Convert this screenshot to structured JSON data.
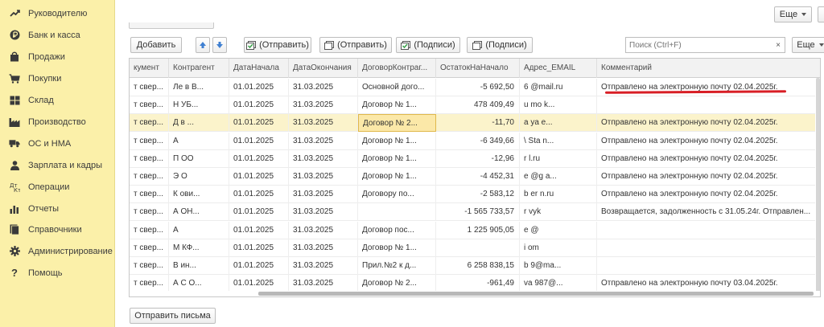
{
  "colors": {
    "sidebar_bg": "#fbf0a9",
    "selection_bg": "#fbf3cb",
    "accent_red": "#d81e25",
    "arrow_blue": "#3f7fd1",
    "check_green": "#3aa14a"
  },
  "sidebar": {
    "items": [
      {
        "label": "Руководителю",
        "icon": "chart-trend-icon"
      },
      {
        "label": "Банк и касса",
        "icon": "ruble-coin-icon"
      },
      {
        "label": "Продажи",
        "icon": "shopping-bag-icon"
      },
      {
        "label": "Покупки",
        "icon": "cart-icon"
      },
      {
        "label": "Склад",
        "icon": "warehouse-icon"
      },
      {
        "label": "Производство",
        "icon": "factory-icon"
      },
      {
        "label": "ОС и НМА",
        "icon": "truck-icon"
      },
      {
        "label": "Зарплата и кадры",
        "icon": "people-icon"
      },
      {
        "label": "Операции",
        "icon": "operations-icon"
      },
      {
        "label": "Отчеты",
        "icon": "bar-chart-icon"
      },
      {
        "label": "Справочники",
        "icon": "books-icon"
      },
      {
        "label": "Администрирование",
        "icon": "gear-icon"
      },
      {
        "label": "Помощь",
        "icon": "question-icon"
      }
    ]
  },
  "header": {
    "more_label": "Еще"
  },
  "toolbar": {
    "add_label": "Добавить",
    "send_label_1": "(Отправить)",
    "send_label_2": "(Отправить)",
    "sign_label_1": "(Подписи)",
    "sign_label_2": "(Подписи)",
    "search_placeholder": "Поиск (Ctrl+F)",
    "search_clear": "×",
    "more_label": "Еще"
  },
  "table": {
    "columns": [
      "кумент",
      "Контрагент",
      "ДатаНачала",
      "ДатаОкончания",
      "ДоговорКонтраг...",
      "ОстатокНаНачало",
      "Адрес_EMAIL",
      "Комментарий"
    ],
    "rows": [
      [
        "т свер...",
        "Ле   в В...",
        "01.01.2025",
        "31.03.2025",
        "Основной дого...",
        "-5 692,50",
        "6        @mail.ru",
        "Отправлено на электронную почту 02.04.2025г."
      ],
      [
        "т свер...",
        "Н       УБ...",
        "01.01.2025",
        "31.03.2025",
        "Договор № 1...",
        "478 409,49",
        "u        mo  k...",
        ""
      ],
      [
        "т свер...",
        "Д        в ...",
        "01.01.2025",
        "31.03.2025",
        "Договор № 2...",
        "-11,70",
        "a         ya   e...",
        "Отправлено на электронную почту 02.04.2025г."
      ],
      [
        "т свер...",
        "А",
        "01.01.2025",
        "31.03.2025",
        "Договор № 1...",
        "-6 349,66",
        "\\          Sta  n...",
        "Отправлено на электронную почту 02.04.2025г."
      ],
      [
        "т свер...",
        "П       ОО",
        "01.01.2025",
        "31.03.2025",
        "Договор № 1...",
        "-12,96",
        "r          l.ru",
        "Отправлено на электронную почту 02.04.2025г."
      ],
      [
        "т свер...",
        "Э       О",
        "01.01.2025",
        "31.03.2025",
        "Договор № 1...",
        "-4 452,31",
        "e          @g  a...",
        "Отправлено на электронную почту 02.04.2025г."
      ],
      [
        "т свер...",
        "К      ови...",
        "01.01.2025",
        "31.03.2025",
        "Договору по...",
        "-2 583,12",
        "b          er  n.ru",
        "Отправлено на электронную почту 02.04.2025г."
      ],
      [
        "т свер...",
        "А       ОН...",
        "01.01.2025",
        "31.03.2025",
        "",
        "-1 565 733,57",
        "r          vyk",
        "Возвращается, задолженность с 31.05.24г. Отправлен..."
      ],
      [
        "т свер...",
        "А",
        "01.01.2025",
        "31.03.2025",
        "Договор пос...",
        "1 225 905,05",
        "e         @",
        ""
      ],
      [
        "т свер...",
        "М        КФ...",
        "01.01.2025",
        "31.03.2025",
        "Договор № 1...",
        "",
        "i           om",
        ""
      ],
      [
        "т свер...",
        "В        ин...",
        "01.01.2025",
        "31.03.2025",
        "Прил.№2 к д...",
        "6 258 838,15",
        "b          9@ma...",
        ""
      ],
      [
        "т свер...",
        "А        С О...",
        "01.01.2025",
        "31.03.2025",
        "Договор № 2...",
        "-961,49",
        "va         987@...",
        "Отправлено на электронную почту 03.04.2025г."
      ]
    ]
  },
  "footer": {
    "send_letters_label": "Отправить письма"
  }
}
